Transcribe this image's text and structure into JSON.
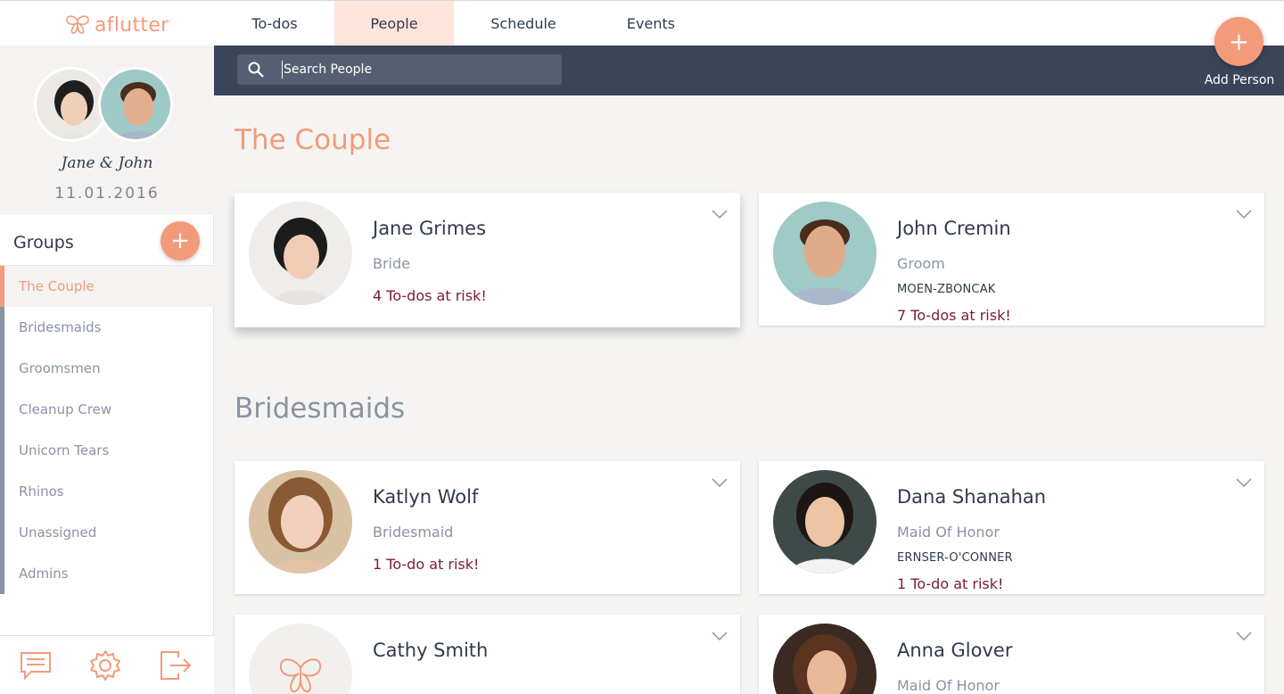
{
  "app": {
    "logo_text": "aflutter"
  },
  "nav": {
    "tabs": [
      "To-dos",
      "People",
      "Schedule",
      "Events"
    ],
    "active": "People"
  },
  "profile": {
    "names": "Jane & John",
    "date": "11.01.2016"
  },
  "groups": {
    "title": "Groups",
    "add_label": "+",
    "items": [
      "The Couple",
      "Bridesmaids",
      "Groomsmen",
      "Cleanup Crew",
      "Unicorn Tears",
      "Rhinos",
      "Unassigned",
      "Admins"
    ],
    "active": "The Couple"
  },
  "search": {
    "placeholder": "Search People"
  },
  "add_person": {
    "icon": "+",
    "label": "Add Person"
  },
  "sections": [
    {
      "title": "The Couple",
      "people": [
        {
          "name": "Jane Grimes",
          "role": "Bride",
          "company": "",
          "risk": "4 To-dos at risk!"
        },
        {
          "name": "John Cremin",
          "role": "Groom",
          "company": "MOEN-ZBONCAK",
          "risk": "7 To-dos at risk!"
        }
      ]
    },
    {
      "title": "Bridesmaids",
      "people": [
        {
          "name": "Katlyn Wolf",
          "role": "Bridesmaid",
          "company": "",
          "risk": "1 To-do at risk!"
        },
        {
          "name": "Dana Shanahan",
          "role": "Maid Of Honor",
          "company": "ERNSER-O'CONNER",
          "risk": "1 To-do at risk!"
        },
        {
          "name": "Cathy Smith",
          "role": "",
          "company": "",
          "risk": ""
        },
        {
          "name": "Anna Glover",
          "role": "Maid Of Honor",
          "company": "",
          "risk": ""
        }
      ]
    }
  ],
  "colors": {
    "accent": "#f39a7b",
    "navy": "#3b4559",
    "muted": "#8a93a3",
    "risk": "#7a1a3a",
    "active_tab_bg": "#fde5dc"
  },
  "icons": {
    "footer": [
      "chat-icon",
      "gear-icon",
      "logout-icon"
    ]
  }
}
